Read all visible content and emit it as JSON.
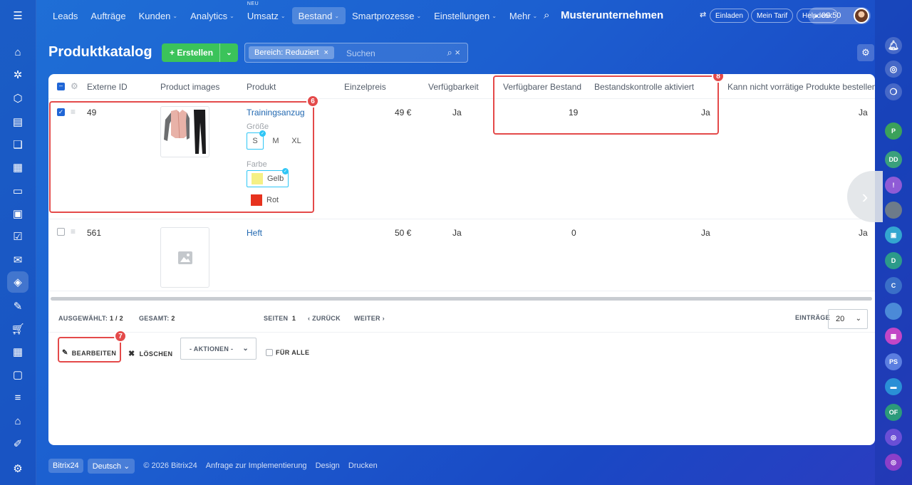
{
  "topnav": {
    "items": [
      {
        "label": "Leads",
        "chev": false
      },
      {
        "label": "Aufträge",
        "chev": false
      },
      {
        "label": "Kunden",
        "chev": true
      },
      {
        "label": "Analytics",
        "chev": true
      },
      {
        "label": "Umsatz",
        "chev": true,
        "badge": "NEU"
      },
      {
        "label": "Bestand",
        "chev": true,
        "active": true
      },
      {
        "label": "Smartprozesse",
        "chev": true
      },
      {
        "label": "Einstellungen",
        "chev": true
      },
      {
        "label": "Mehr",
        "chev": true
      }
    ],
    "company": "Musterunternehmen",
    "invite": "Einladen",
    "tariff": "Mein Tarif",
    "helpdesk": "Helpdesk",
    "time": "09:50"
  },
  "page": {
    "title": "Produktkatalog",
    "create_label": "Erstellen",
    "filter_tag": "Bereich: Reduziert",
    "search_placeholder": "Suchen"
  },
  "table": {
    "columns": [
      "Externe ID",
      "Product images",
      "Produkt",
      "Einzelpreis",
      "Verfügbarkeit",
      "Verfügbarer Bestand",
      "Bestandskontrolle aktiviert",
      "Kann nicht vorrätige Produkte bestellen"
    ],
    "rows": [
      {
        "id": "49",
        "product": "Trainingsanzug",
        "price": "49 €",
        "available": "Ja",
        "stock": "19",
        "control": "Ja",
        "order": "Ja",
        "checked": true,
        "size_label": "Größe",
        "sizes": [
          "S",
          "M",
          "XL"
        ],
        "color_label": "Farbe",
        "colors": [
          {
            "name": "Gelb",
            "hex": "#f5f085"
          },
          {
            "name": "Rot",
            "hex": "#e7321e"
          }
        ]
      },
      {
        "id": "561",
        "product": "Heft",
        "price": "50 €",
        "available": "Ja",
        "stock": "0",
        "control": "Ja",
        "order": "Ja",
        "checked": false
      }
    ]
  },
  "pager": {
    "selected_label": "AUSGEWÄHLT:",
    "selected": "1 / 2",
    "total_label": "GESAMT:",
    "total": "2",
    "pages_label": "SEITEN",
    "page": "1",
    "back": "ZURÜCK",
    "next": "WEITER",
    "entries_label": "EINTRÄGE",
    "per_page": "20"
  },
  "actions": {
    "edit": "BEARBEITEN",
    "delete": "LÖSCHEN",
    "select": "- AKTIONEN -",
    "all": "FÜR ALLE"
  },
  "markers": {
    "m6": "6",
    "m7": "7",
    "m8": "8"
  },
  "footer": {
    "brand": "Bitrix24",
    "lang": "Deutsch",
    "copyright": "© 2026 Bitrix24",
    "link1": "Anfrage zur Implementierung",
    "link2": "Design",
    "link3": "Drucken"
  },
  "rightbar": {
    "avatars": [
      "P",
      "DD",
      "D",
      "C",
      "PS",
      "OF"
    ]
  },
  "colors": {
    "accent": "#2066d6",
    "create": "#3bc35a",
    "highlight": "#e44a4a",
    "link": "#2067b0"
  }
}
